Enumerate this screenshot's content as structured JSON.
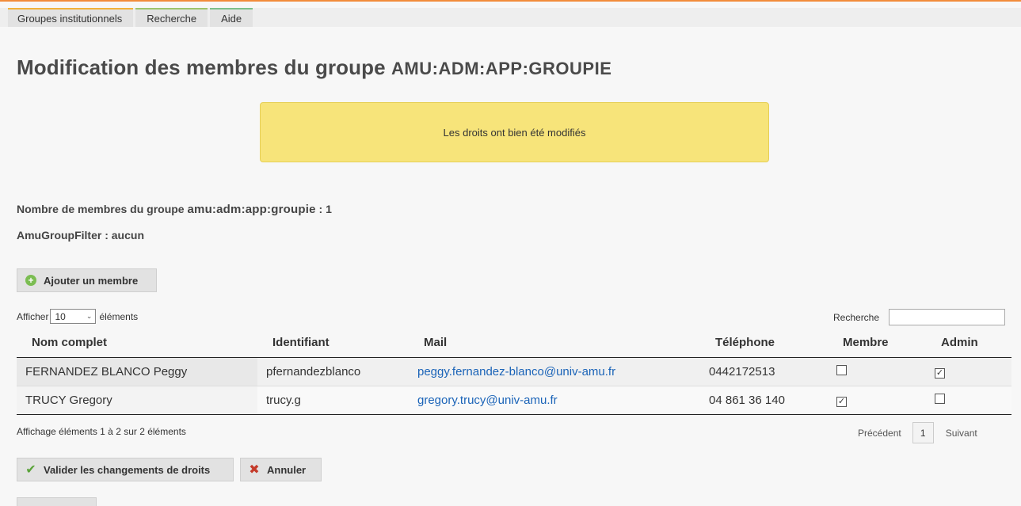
{
  "nav": {
    "tabs": [
      "Groupes institutionnels",
      "Recherche",
      "Aide"
    ]
  },
  "page": {
    "title_prefix": "Modification des membres du groupe",
    "group_name": "AMU:ADM:APP:GROUPIE"
  },
  "alert": {
    "message": "Les droits ont bien été modifiés"
  },
  "summary": {
    "members_label": "Nombre de membres du groupe",
    "group_lower": "amu:adm:app:groupie",
    "members_count": ": 1",
    "filter_label": "AmuGroupFilter : aucun"
  },
  "buttons": {
    "add_member": "Ajouter un membre",
    "validate": "Valider les changements de droits",
    "cancel": "Annuler"
  },
  "table_controls": {
    "show_prefix": "Afficher",
    "page_length": "10",
    "show_suffix": "éléments",
    "search_label": "Recherche",
    "search_value": ""
  },
  "table": {
    "columns": [
      "Nom complet",
      "Identifiant",
      "Mail",
      "Téléphone",
      "Membre",
      "Admin"
    ],
    "rows": [
      {
        "name": "FERNANDEZ BLANCO Peggy",
        "uid": "pfernandezblanco",
        "mail": "peggy.fernandez-blanco@univ-amu.fr",
        "phone": "0442172513",
        "member_checked": false,
        "admin_checked": true
      },
      {
        "name": "TRUCY Gregory",
        "uid": "trucy.g",
        "mail": "gregory.trucy@univ-amu.fr",
        "phone": "04 861 36 140",
        "member_checked": true,
        "admin_checked": false
      }
    ]
  },
  "pagination": {
    "info": "Affichage éléments 1 à 2 sur 2 éléments",
    "previous": "Précédent",
    "current": "1",
    "next": "Suivant"
  },
  "colors": {
    "accent_line": "#f28c3a",
    "alert_bg": "#f7e47a",
    "link": "#1b64b8"
  }
}
